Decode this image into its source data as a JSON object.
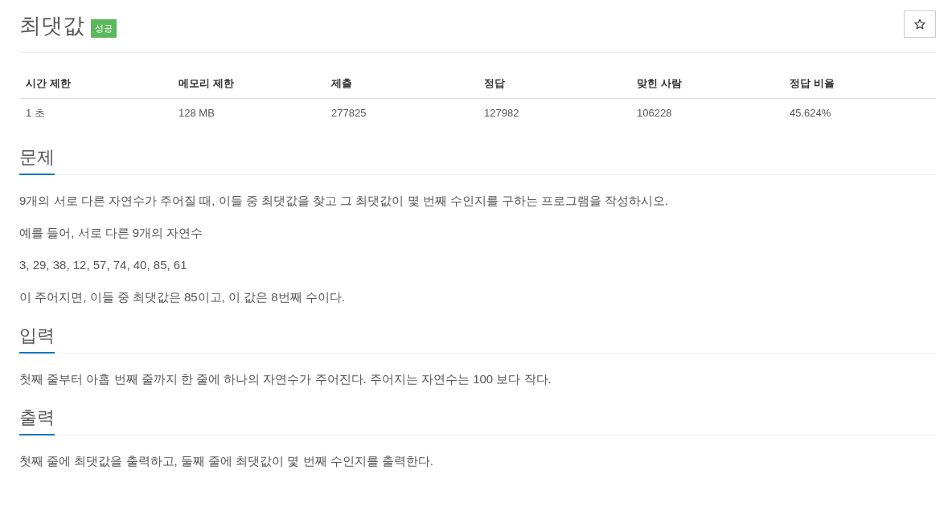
{
  "title": "최댓값",
  "badge": "성공",
  "stats": {
    "columns": [
      "시간 제한",
      "메모리 제한",
      "제출",
      "정답",
      "맞힌 사람",
      "정답 비율"
    ],
    "rows": [
      [
        "1 초",
        "128 MB",
        "277825",
        "127982",
        "106228",
        "45.624%"
      ]
    ]
  },
  "sections": [
    {
      "heading": "문제",
      "paragraphs": [
        "9개의 서로 다른 자연수가 주어질 때, 이들 중 최댓값을 찾고 그 최댓값이 몇 번째 수인지를 구하는 프로그램을 작성하시오.",
        "예를 들어, 서로 다른 9개의 자연수",
        "3, 29, 38, 12, 57, 74, 40, 85, 61",
        "이 주어지면, 이들 중 최댓값은 85이고, 이 값은 8번째 수이다."
      ]
    },
    {
      "heading": "입력",
      "paragraphs": [
        "첫째 줄부터 아홉 번째 줄까지 한 줄에 하나의 자연수가 주어진다. 주어지는 자연수는 100 보다 작다."
      ]
    },
    {
      "heading": "출력",
      "paragraphs": [
        "첫째 줄에 최댓값을 출력하고, 둘째 줄에 최댓값이 몇 번째 수인지를 출력한다."
      ]
    }
  ]
}
